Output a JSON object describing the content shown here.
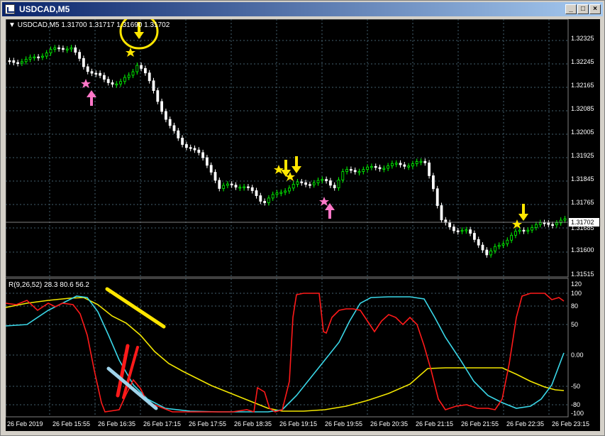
{
  "window": {
    "title": "USDCAD,M5",
    "controls": {
      "minimize": "_",
      "maximize": "□",
      "close": "×"
    }
  },
  "chart": {
    "symbol": "USDCAD,M5",
    "ohlc": "1.31700 1.31717 1.31690 1.31702",
    "price_labels": [
      "1.32325",
      "1.32245",
      "1.32165",
      "1.32085",
      "1.32005",
      "1.31925",
      "1.31845",
      "1.31765",
      "1.31685",
      "1.31600",
      "1.31515"
    ],
    "current_price": "1.31702",
    "time_labels": [
      "26 Feb 2019",
      "26 Feb 15:55",
      "26 Feb 16:35",
      "26 Feb 17:15",
      "26 Feb 17:55",
      "26 Feb 18:35",
      "26 Feb 19:15",
      "26 Feb 19:55",
      "26 Feb 20:35",
      "26 Feb 21:15",
      "26 Feb 21:55",
      "26 Feb 22:35",
      "26 Feb 23:15"
    ]
  },
  "indicator": {
    "label": "R(9,26,52) 28.3 80.6 56.2",
    "scale_labels": [
      "120",
      "100",
      "80",
      "50",
      "0.00",
      "-50",
      "-80",
      "-100"
    ]
  },
  "colors": {
    "bull_candle": "#00ff00",
    "bear_candle": "#ffffff",
    "grid": "#4a6a7a",
    "annotation_yellow": "#ffe600",
    "annotation_pink": "#ff77c8",
    "line_red": "#ff1a1a",
    "line_cyan": "#3ad7e8",
    "line_yellow": "#f2e600"
  }
}
